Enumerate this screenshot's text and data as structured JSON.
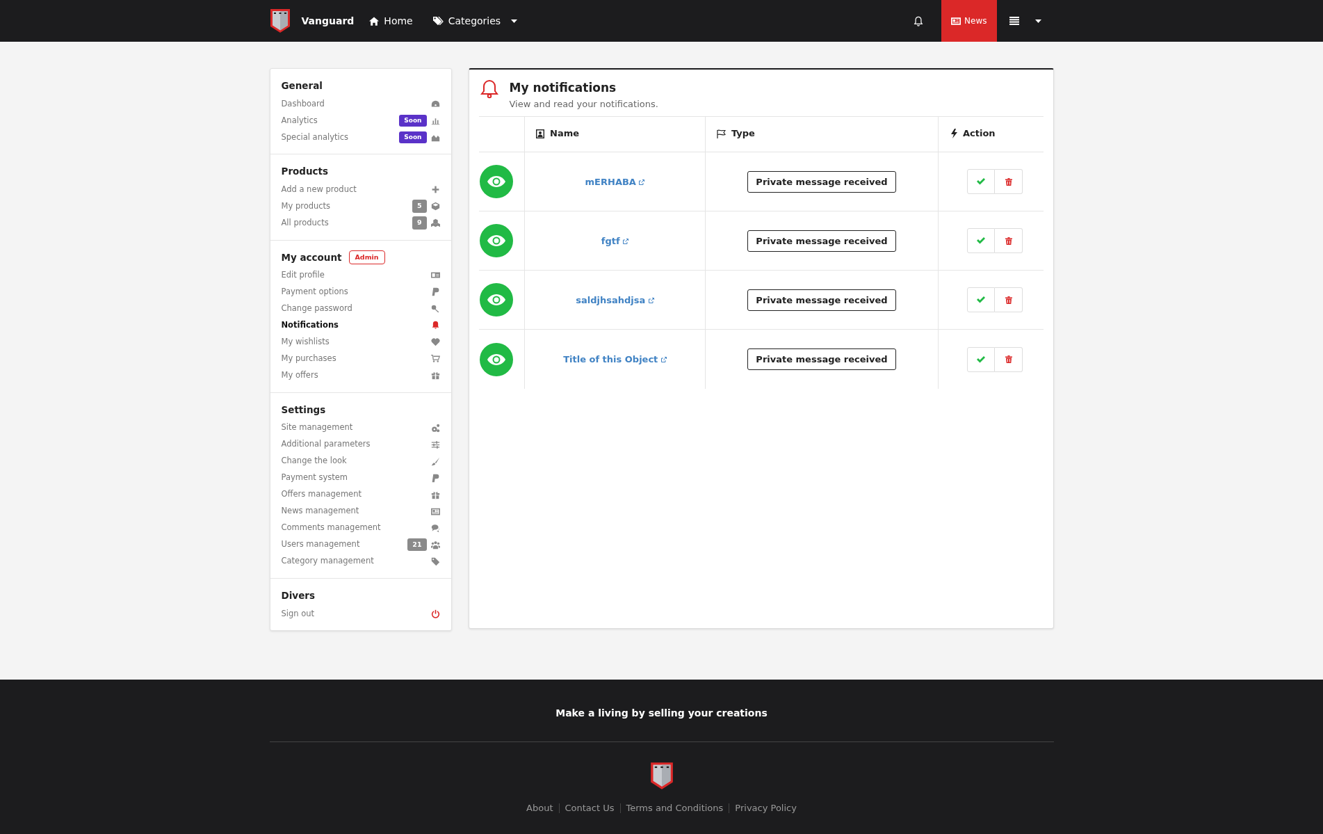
{
  "navbar": {
    "brand": "Vanguard",
    "links": [
      {
        "label": "Home",
        "kind": "link"
      },
      {
        "label": "Categories",
        "kind": "dropdown"
      }
    ],
    "news": {
      "label": "News",
      "selected": true
    }
  },
  "sidebar": {
    "sections": [
      {
        "title": "General",
        "items": [
          {
            "label": "Dashboard",
            "selected": false
          },
          {
            "label": "Analytics",
            "badge": {
              "text": "Soon",
              "kind": "soon"
            },
            "selected": false
          },
          {
            "label": "Special analytics",
            "badge": {
              "text": "Soon",
              "kind": "soon"
            },
            "selected": false
          }
        ]
      },
      {
        "title": "Products",
        "items": [
          {
            "label": "Add a new product",
            "selected": false
          },
          {
            "label": "My products",
            "badge": {
              "text": "5",
              "kind": "count"
            },
            "selected": false
          },
          {
            "label": "All products",
            "badge": {
              "text": "9",
              "kind": "count"
            },
            "selected": false
          }
        ]
      },
      {
        "title": "My account",
        "tag": "Admin",
        "items": [
          {
            "label": "Edit profile",
            "selected": false
          },
          {
            "label": "Payment options",
            "selected": false
          },
          {
            "label": "Change password",
            "selected": false
          },
          {
            "label": "Notifications",
            "selected": true
          },
          {
            "label": "My wishlists",
            "selected": false
          },
          {
            "label": "My purchases",
            "selected": false
          },
          {
            "label": "My offers",
            "selected": false
          }
        ]
      },
      {
        "title": "Settings",
        "items": [
          {
            "label": "Site management",
            "selected": false
          },
          {
            "label": "Additional parameters",
            "selected": false
          },
          {
            "label": "Change the look",
            "selected": false
          },
          {
            "label": "Payment system",
            "selected": false
          },
          {
            "label": "Offers management",
            "selected": false
          },
          {
            "label": "News management",
            "selected": false
          },
          {
            "label": "Comments management",
            "selected": false
          },
          {
            "label": "Users management",
            "badge": {
              "text": "21",
              "kind": "count"
            },
            "selected": false
          },
          {
            "label": "Category management",
            "selected": false
          }
        ]
      },
      {
        "title": "Divers",
        "items": [
          {
            "label": "Sign out",
            "selected": false
          }
        ]
      }
    ]
  },
  "panel": {
    "title": "My notifications",
    "subtitle": "View and read your notifications.",
    "table": {
      "columns": [
        "Name",
        "Type",
        "Action"
      ],
      "rows": [
        {
          "name": "mERHABA",
          "type": "Private message received"
        },
        {
          "name": "fgtf",
          "type": "Private message received"
        },
        {
          "name": "saldjhsahdjsa",
          "type": "Private message received"
        },
        {
          "name": "Title of this Object",
          "type": "Private message received"
        }
      ]
    }
  },
  "footer": {
    "tagline": "Make a living by selling your creations",
    "links": [
      "About",
      "Contact Us",
      "Terms and Conditions",
      "Privacy Policy"
    ]
  }
}
